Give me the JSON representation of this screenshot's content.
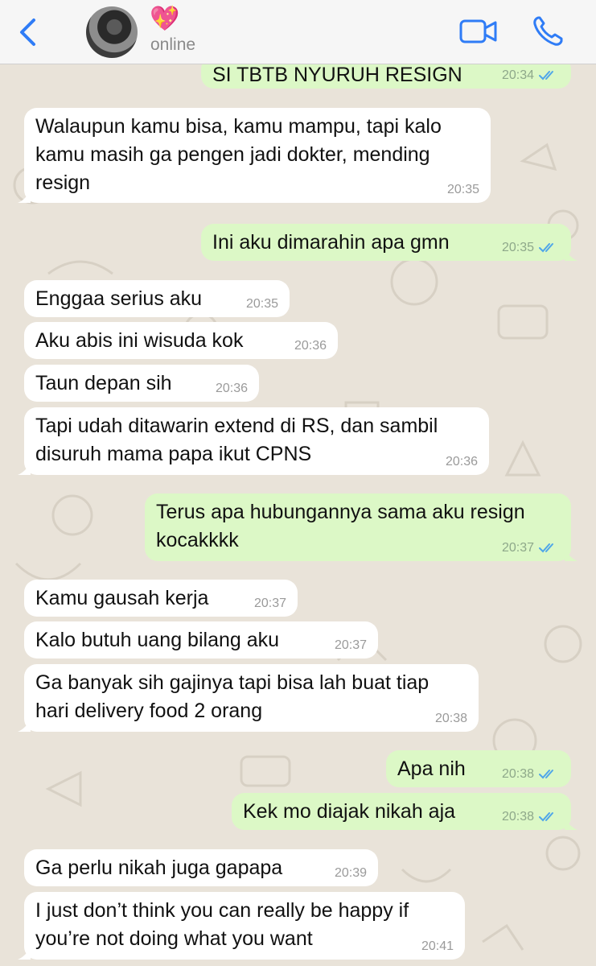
{
  "contact": {
    "name": "💖",
    "status": "online"
  },
  "colors": {
    "incoming_bubble": "#ffffff",
    "outgoing_bubble": "#dcf8c6",
    "accent": "#2f7cf6",
    "read_ticks": "#4fa6e9"
  },
  "icons": {
    "back": "chevron-left-icon",
    "video": "video-camera-icon",
    "call": "phone-icon",
    "read": "double-check-icon"
  },
  "messages": [
    {
      "dir": "out",
      "text": "SI TBTB NYURUH RESIGN",
      "time": "20:34",
      "read": true
    },
    {
      "dir": "in",
      "text": "Walaupun kamu bisa, kamu mampu, tapi kalo\nkamu masih ga pengen jadi dokter, mending\nresign",
      "time": "20:35"
    },
    {
      "dir": "out",
      "text": "Ini aku dimarahin apa gmn",
      "time": "20:35",
      "read": true
    },
    {
      "dir": "in",
      "text": "Enggaa serius aku",
      "time": "20:35"
    },
    {
      "dir": "in",
      "text": "Aku abis ini wisuda kok",
      "time": "20:36"
    },
    {
      "dir": "in",
      "text": "Taun depan sih",
      "time": "20:36"
    },
    {
      "dir": "in",
      "text": "Tapi udah ditawarin extend di RS, dan sambil\ndisuruh mama papa ikut CPNS",
      "time": "20:36"
    },
    {
      "dir": "out",
      "text": "Terus apa hubungannya sama aku resign\nkocakkkk",
      "time": "20:37",
      "read": true
    },
    {
      "dir": "in",
      "text": "Kamu gausah kerja",
      "time": "20:37"
    },
    {
      "dir": "in",
      "text": "Kalo butuh uang bilang aku",
      "time": "20:37"
    },
    {
      "dir": "in",
      "text": "Ga banyak sih gajinya tapi bisa lah buat tiap\nhari delivery food 2 orang",
      "time": "20:38"
    },
    {
      "dir": "out",
      "text": "Apa nih",
      "time": "20:38",
      "read": true
    },
    {
      "dir": "out",
      "text": "Kek mo diajak nikah aja",
      "time": "20:38",
      "read": true
    },
    {
      "dir": "in",
      "text": "Ga perlu nikah juga gapapa",
      "time": "20:39"
    },
    {
      "dir": "in",
      "text": "I just don’t think you can really be happy if\nyou’re not doing what you want",
      "time": "20:41"
    }
  ]
}
